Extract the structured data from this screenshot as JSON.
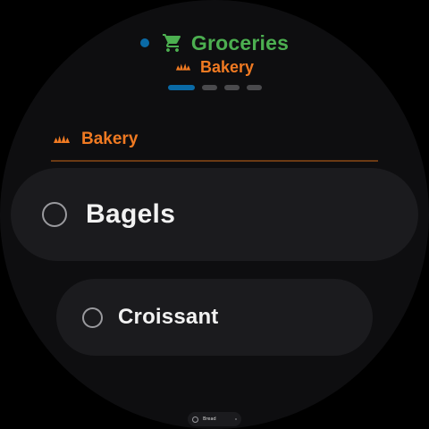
{
  "header": {
    "title": "Groceries",
    "subtitle": "Bakery",
    "icon": "cart-icon",
    "subtitle_icon": "croissant-icon",
    "status_color": "#0a6aa6",
    "title_color": "#4caf50"
  },
  "pager": {
    "count": 4,
    "active_index": 0
  },
  "section": {
    "label": "Bakery",
    "icon": "croissant-icon",
    "accent_color": "#f07a22"
  },
  "items": [
    {
      "label": "Bagels",
      "checked": false
    },
    {
      "label": "Croissant",
      "checked": false
    }
  ],
  "peek_item": {
    "label": "Bread",
    "checked": false
  }
}
